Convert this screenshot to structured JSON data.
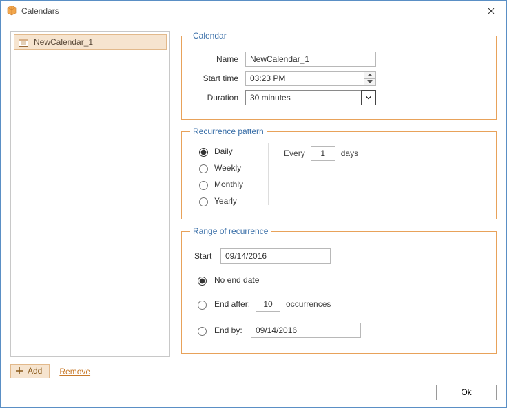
{
  "window": {
    "title": "Calendars"
  },
  "sidebar": {
    "items": [
      {
        "label": "NewCalendar_1"
      }
    ]
  },
  "actions": {
    "add_label": "Add",
    "remove_label": "Remove"
  },
  "calendar": {
    "legend": "Calendar",
    "name_label": "Name",
    "name_value": "NewCalendar_1",
    "start_label": "Start time",
    "start_value": "03:23 PM",
    "duration_label": "Duration",
    "duration_value": "30 minutes"
  },
  "recurrence": {
    "legend": "Recurrence pattern",
    "options": {
      "daily": "Daily",
      "weekly": "Weekly",
      "monthly": "Monthly",
      "yearly": "Yearly"
    },
    "selected": "daily",
    "every_label": "Every",
    "every_value": "1",
    "every_unit": "days"
  },
  "range": {
    "legend": "Range of recurrence",
    "start_label": "Start",
    "start_value": "09/14/2016",
    "noend_label": "No end date",
    "end_after_label": "End after:",
    "end_after_value": "10",
    "end_after_unit": "occurrences",
    "end_by_label": "End by:",
    "end_by_value": "09/14/2016",
    "selected": "noend"
  },
  "footer": {
    "ok_label": "Ok"
  }
}
